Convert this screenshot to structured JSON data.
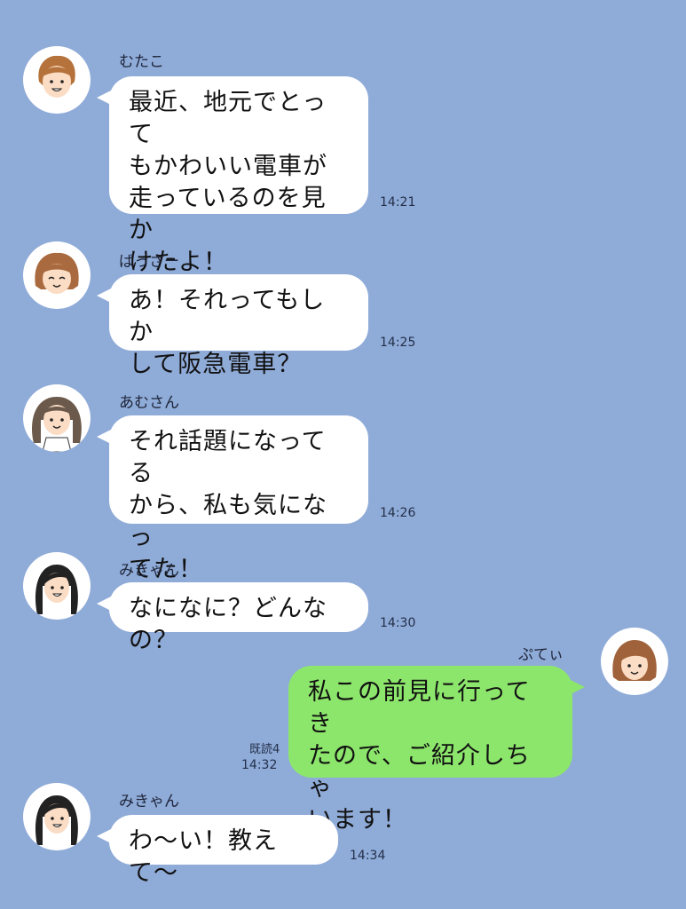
{
  "colors": {
    "background": "#8fabd8",
    "incoming_bubble": "#ffffff",
    "outgoing_bubble": "#8de66c"
  },
  "messages": [
    {
      "sender": "むたこ",
      "text": "最近、地元でとって\nもかわいい電車が\n走っているのを見か\nけたよ！",
      "time": "14:21"
    },
    {
      "sender": "ばっさー",
      "text": "あ！それってもしか\nして阪急電車？",
      "time": "14:25"
    },
    {
      "sender": "あむさん",
      "text": "それ話題になってる\nから、私も気になっ\nてた！",
      "time": "14:26"
    },
    {
      "sender": "みきゃん",
      "text": "なになに？どんなの？",
      "time": "14:30"
    },
    {
      "sender": "ぷてぃ",
      "text": "私この前見に行ってき\nたので、ご紹介しちゃ\nいます！",
      "time": "14:32",
      "read": "既読4"
    },
    {
      "sender": "みきゃん",
      "text": "わ〜い！教えて〜",
      "time": "14:34"
    }
  ]
}
